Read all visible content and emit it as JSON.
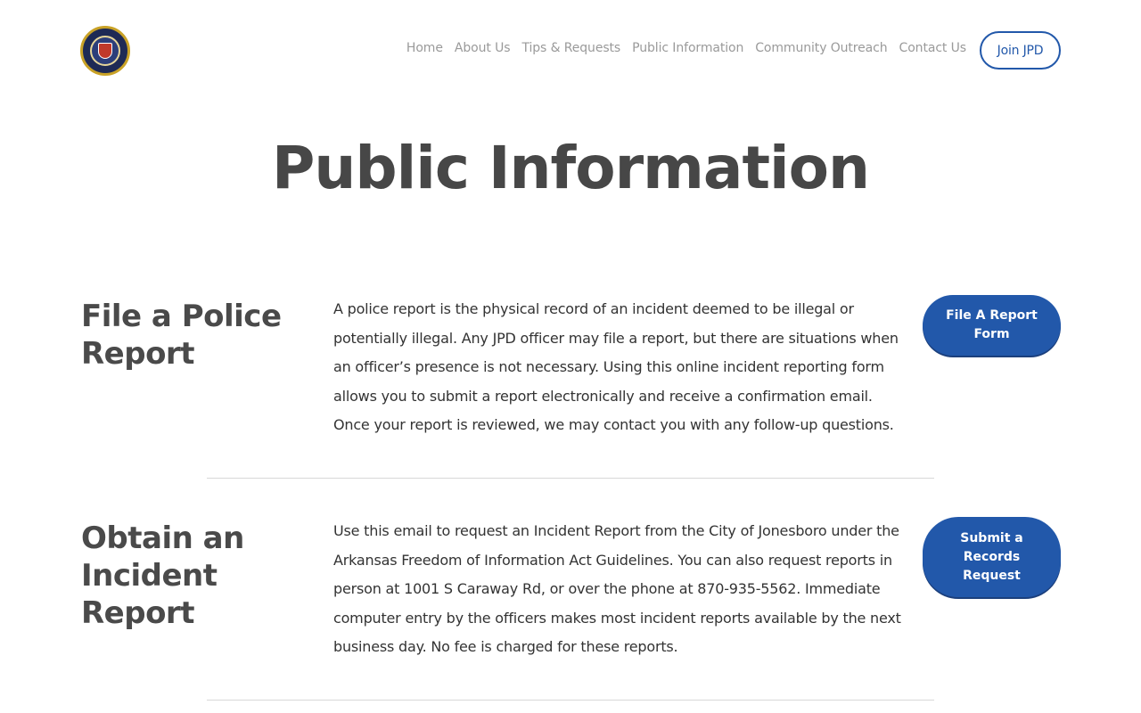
{
  "nav": {
    "items": [
      "Home",
      "About Us",
      "Tips & Requests",
      "Public Information",
      "Community Outreach",
      "Contact Us"
    ],
    "join_label": "Join JPD"
  },
  "page": {
    "title": "Public Information"
  },
  "sections": [
    {
      "title": "File a Police Report",
      "body": "A police report is the physical record of an incident deemed to be illegal or potentially illegal. Any JPD officer may file a report, but there are situations when an officer’s presence is not necessary. Using this online incident reporting form allows you to submit a report electronically and receive a confirmation email. Once your report is reviewed, we may contact you with any follow-up questions.",
      "button": "File A Report Form"
    },
    {
      "title": "Obtain an Incident Report",
      "body": "Use this email to request an Incident Report from the City of Jonesboro under the Arkansas Freedom of Information Act Guidelines. You can also request reports in person at 1001 S Caraway Rd, or over the phone at 870-935-5562. Immediate computer entry by the officers makes most incident reports available by the next business day. No fee is charged for these reports.",
      "button": "Submit a Records Request"
    }
  ],
  "colors": {
    "accent": "#2258aa",
    "title": "#474747",
    "nav": "#9a9a9a"
  }
}
